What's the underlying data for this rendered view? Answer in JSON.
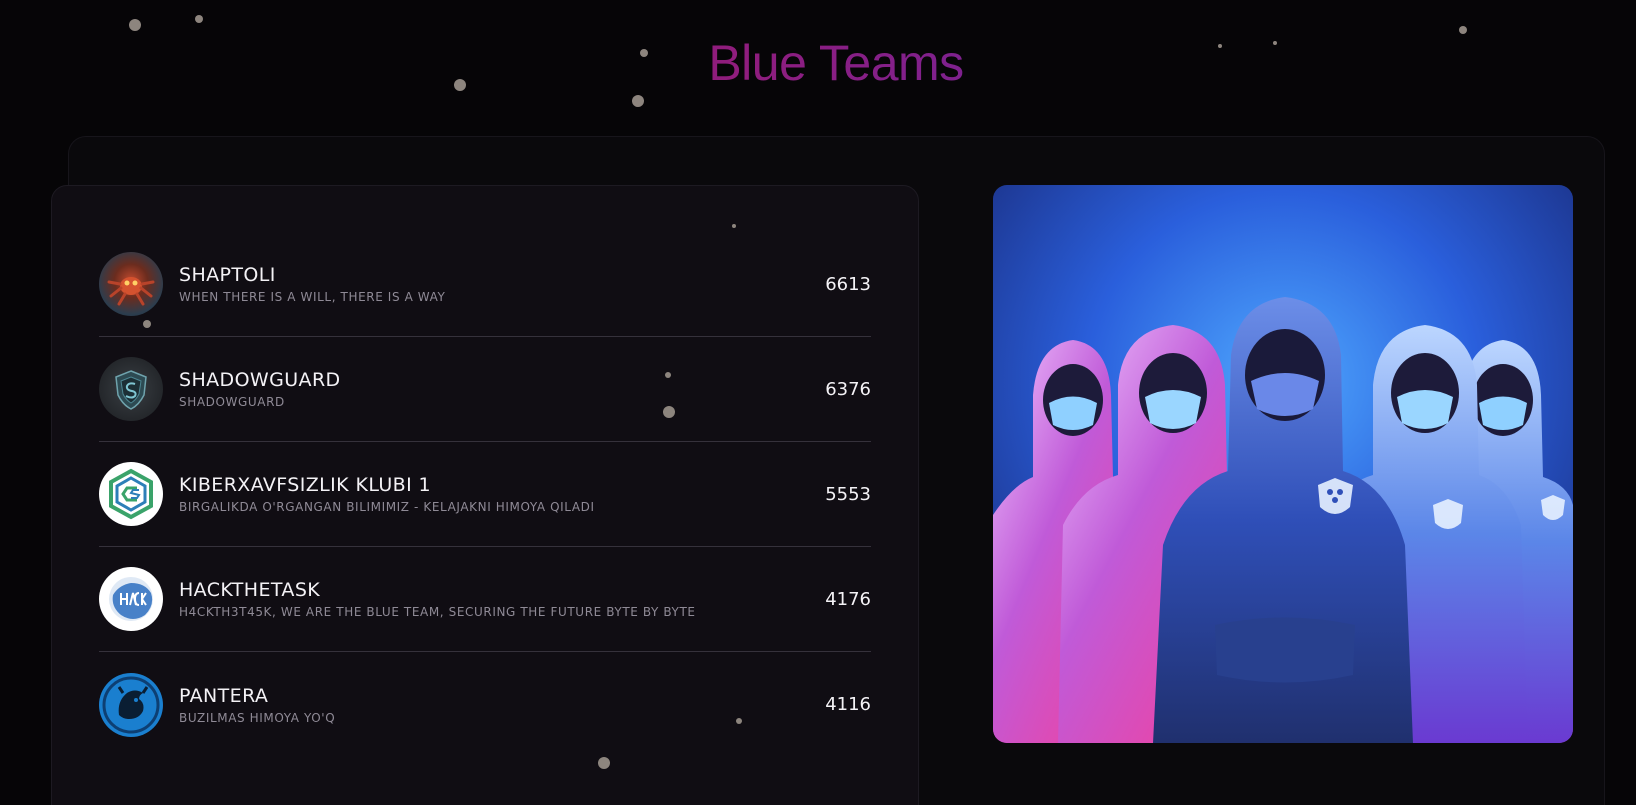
{
  "page": {
    "title": "Blue Teams"
  },
  "teams": [
    {
      "name": "SHAPTOLI",
      "motto": "WHEN THERE IS A WILL, THERE IS A WAY",
      "score": "6613",
      "avatar": "spider-robot-avatar-icon"
    },
    {
      "name": "SHADOWGUARD",
      "motto": "SHADOWGUARD",
      "score": "6376",
      "avatar": "shield-logo-icon"
    },
    {
      "name": "KIBERXAVFSIZLIK KLUBI 1",
      "motto": "BIRGALIKDA O'RGANGAN BILIMIMIZ - KELAJAKNI HIMOYA QILADI",
      "score": "5553",
      "avatar": "hexagon-cs-logo-icon"
    },
    {
      "name": "HACKTHETASK",
      "motto": "H4CKTH3T45K, WE ARE THE BLUE TEAM, SECURING THE FUTURE BYTE BY BYTE",
      "score": "4176",
      "avatar": "hack-the-task-logo-icon"
    },
    {
      "name": "PANTERA",
      "motto": "BUZILMAS HIMOYA YO'Q",
      "score": "4116",
      "avatar": "panther-logo-icon"
    }
  ],
  "hero": {
    "image": "hooded-blue-team-illustration"
  },
  "colors": {
    "title_start": "#a5154f",
    "title_end": "#4a2fc4",
    "background": "#060507",
    "card": "#100d13"
  }
}
